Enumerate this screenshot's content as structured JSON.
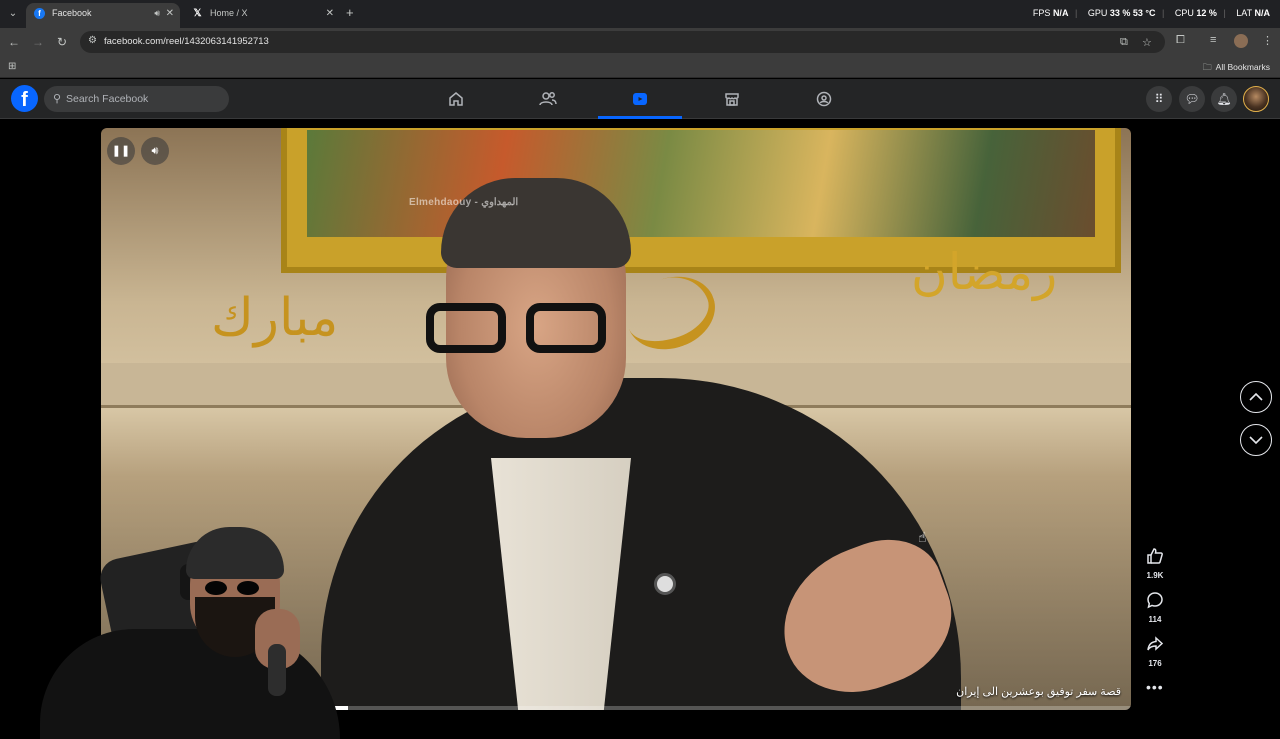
{
  "browser": {
    "tabs": [
      {
        "title": "Facebook",
        "active": true
      },
      {
        "title": "Home / X",
        "active": false
      }
    ],
    "new_tab_glyph": "+",
    "url": "facebook.com/reel/1432063141952713",
    "all_bookmarks_label": "All Bookmarks",
    "hud": {
      "fps_label": "FPS",
      "fps_value": "N/A",
      "gpu_label": "GPU",
      "gpu_value": "33 %",
      "gpu_temp": "53 °C",
      "cpu_label": "CPU",
      "cpu_value": "12 %",
      "lat_label": "LAT",
      "lat_value": "N/A"
    }
  },
  "facebook": {
    "logo_letter": "f",
    "search_placeholder": "Search Facebook",
    "nav_items": [
      {
        "id": "home",
        "icon": "home-icon",
        "active": false
      },
      {
        "id": "friends",
        "icon": "friends-icon",
        "active": false
      },
      {
        "id": "video",
        "icon": "video-icon",
        "active": true
      },
      {
        "id": "marketplace",
        "icon": "marketplace-icon",
        "active": false
      },
      {
        "id": "groups",
        "icon": "groups-icon",
        "active": false
      }
    ],
    "accent_color": "#0866ff"
  },
  "reel": {
    "watermark": "Elmehdaouy - المهداوي",
    "caption": "قصة سفر توفيق بوعشرين الى إيران",
    "progress": 0.24,
    "actions": {
      "likes": "1.9K",
      "comments": "114",
      "shares": "176"
    },
    "more_glyph": "•••"
  }
}
